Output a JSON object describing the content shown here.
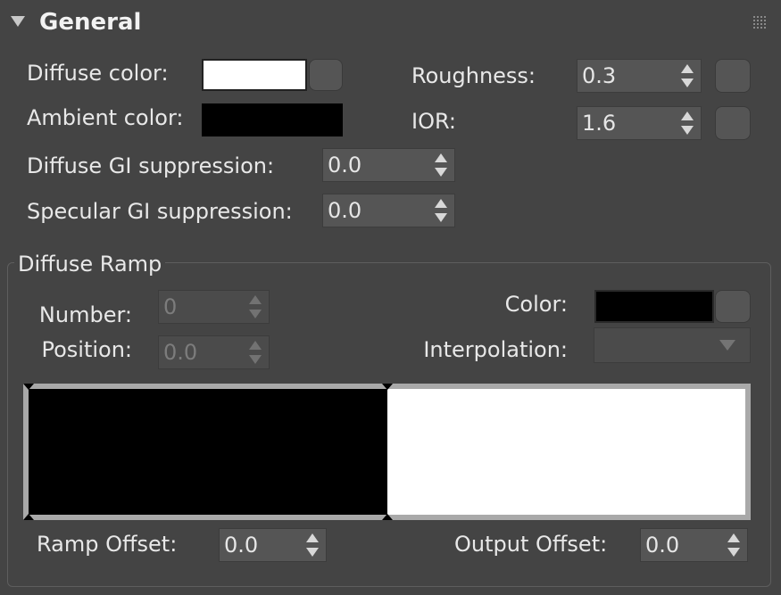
{
  "panel": {
    "title": "General"
  },
  "general": {
    "diffuse_color": {
      "label": "Diffuse color:",
      "value": "#ffffff"
    },
    "ambient_color": {
      "label": "Ambient color:",
      "value": "#000000"
    },
    "diffuse_gi": {
      "label": "Diffuse GI suppression:",
      "value": "0.0"
    },
    "specular_gi": {
      "label": "Specular GI suppression:",
      "value": "0.0"
    },
    "roughness": {
      "label": "Roughness:",
      "value": "0.3"
    },
    "ior": {
      "label": "IOR:",
      "value": "1.6"
    }
  },
  "ramp": {
    "group_label": "Diffuse Ramp",
    "number": {
      "label": "Number:",
      "value": "0"
    },
    "position": {
      "label": "Position:",
      "value": "0.0"
    },
    "color": {
      "label": "Color:",
      "value": "#000000"
    },
    "interpolation": {
      "label": "Interpolation:",
      "value": ""
    },
    "stops": [
      {
        "position": 0.0,
        "color": "#000000"
      },
      {
        "position": 0.5,
        "color": "#ffffff"
      }
    ],
    "ramp_offset": {
      "label": "Ramp Offset:",
      "value": "0.0"
    },
    "output_offset": {
      "label": "Output Offset:",
      "value": "0.0"
    }
  },
  "icons": {
    "collapse": "triangle-down",
    "grip": "dotted-grip",
    "spinner": "up-down-arrows",
    "dropdown": "triangle-down"
  }
}
